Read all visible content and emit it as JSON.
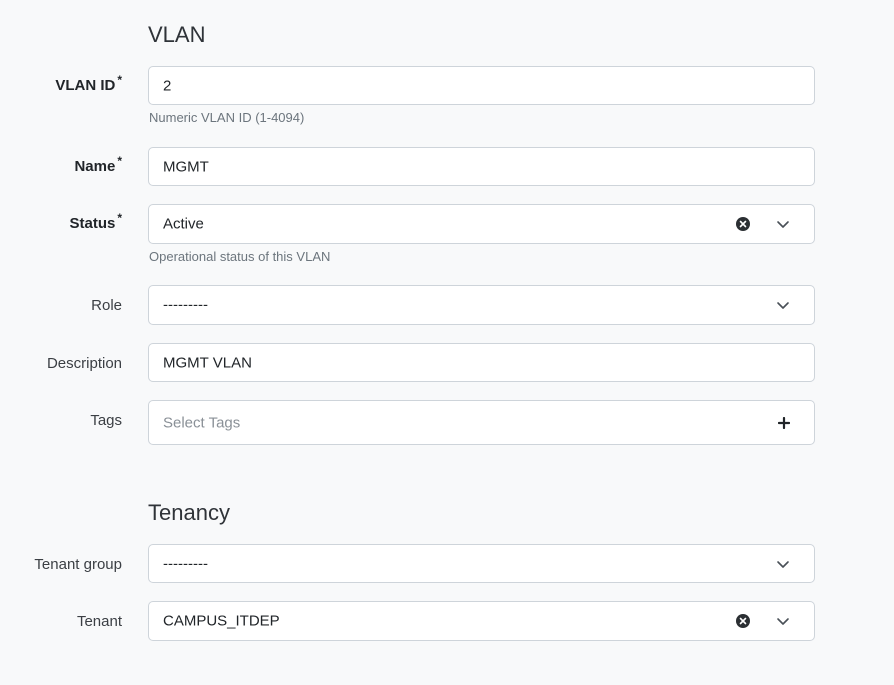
{
  "vlan_section": {
    "title": "VLAN",
    "vlan_id": {
      "label": "VLAN ID",
      "required_mark": "*",
      "value": "2",
      "help": "Numeric VLAN ID (1-4094)"
    },
    "name": {
      "label": "Name",
      "required_mark": "*",
      "value": "MGMT"
    },
    "status": {
      "label": "Status",
      "required_mark": "*",
      "value": "Active",
      "help": "Operational status of this VLAN",
      "clear_icon": "clear-circle-icon",
      "toggle_icon": "chevron-down-icon"
    },
    "role": {
      "label": "Role",
      "value": "---------",
      "toggle_icon": "chevron-down-icon"
    },
    "description": {
      "label": "Description",
      "value": "MGMT VLAN"
    },
    "tags": {
      "label": "Tags",
      "placeholder": "Select Tags",
      "add_icon": "plus-icon"
    }
  },
  "tenancy_section": {
    "title": "Tenancy",
    "tenant_group": {
      "label": "Tenant group",
      "value": "---------",
      "toggle_icon": "chevron-down-icon"
    },
    "tenant": {
      "label": "Tenant",
      "value": "CAMPUS_ITDEP",
      "clear_icon": "clear-circle-icon",
      "toggle_icon": "chevron-down-icon"
    }
  },
  "colors": {
    "background": "#f8f9fa",
    "field_border": "#ced4da",
    "help_text": "#6c757d"
  }
}
